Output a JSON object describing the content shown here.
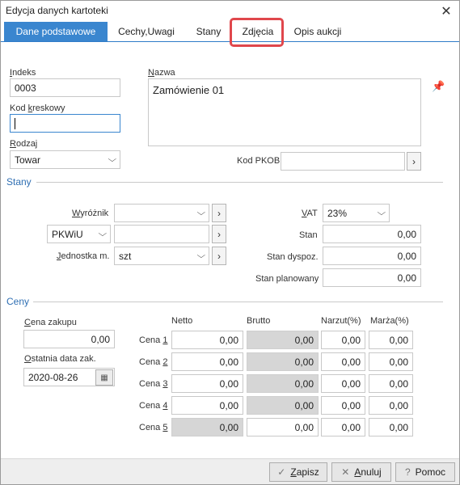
{
  "window": {
    "title": "Edycja danych kartoteki"
  },
  "tabs": [
    {
      "label": "Dane podstawowe"
    },
    {
      "label": "Cechy,Uwagi"
    },
    {
      "label": "Stany"
    },
    {
      "label": "Zdjęcia"
    },
    {
      "label": "Opis aukcji"
    }
  ],
  "basic": {
    "indeks_label_u": "I",
    "indeks_label_rest": "ndeks",
    "indeks_value": "0003",
    "kod_label_a": "Kod ",
    "kod_label_u": "k",
    "kod_label_rest": "reskowy",
    "kod_value": "",
    "rodzaj_label_u": "R",
    "rodzaj_label_rest": "odzaj",
    "rodzaj_value": "Towar",
    "nazwa_label_u": "N",
    "nazwa_label_rest": "azwa",
    "nazwa_value": "Zamówienie 01",
    "pkob_label": "Kod PKOB",
    "pkob_value": ""
  },
  "stany": {
    "title": "Stany",
    "wyroznik_label_u": "W",
    "wyroznik_label_rest": "yróżnik",
    "wyroznik_value": "",
    "pkwiu_select": "PKWiU",
    "pkwiu_value": "",
    "jednostka_label_u": "J",
    "jednostka_label_rest": "ednostka m.",
    "jednostka_value": "szt",
    "vat_label_u": "V",
    "vat_label_rest": "AT",
    "vat_value": "23%",
    "stan_label": "Stan",
    "stan_value": "0,00",
    "stan_dyspoz_label": "Stan dyspoz.",
    "stan_dyspoz_value": "0,00",
    "stan_plan_label": "Stan planowany",
    "stan_plan_value": "0,00"
  },
  "ceny": {
    "title": "Ceny",
    "cena_zakupu_label_u": "C",
    "cena_zakupu_label_rest": "ena zakupu",
    "cena_zakupu_value": "0,00",
    "data_label_u": "O",
    "data_label_rest": "statnia data zak.",
    "data_value": "2020-08-26",
    "columns": [
      "Netto",
      "Brutto",
      "Narzut(%)",
      "Marża(%)"
    ],
    "rows": [
      {
        "label": "Cena ",
        "num": "1",
        "netto": "0,00",
        "brutto": "0,00",
        "narzut": "0,00",
        "marza": "0,00"
      },
      {
        "label": "Cena ",
        "num": "2",
        "netto": "0,00",
        "brutto": "0,00",
        "narzut": "0,00",
        "marza": "0,00"
      },
      {
        "label": "Cena ",
        "num": "3",
        "netto": "0,00",
        "brutto": "0,00",
        "narzut": "0,00",
        "marza": "0,00"
      },
      {
        "label": "Cena ",
        "num": "4",
        "netto": "0,00",
        "brutto": "0,00",
        "narzut": "0,00",
        "marza": "0,00"
      },
      {
        "label": "Cena ",
        "num": "5",
        "netto": "0,00",
        "brutto": "0,00",
        "narzut": "0,00",
        "marza": "0,00"
      }
    ]
  },
  "footer": {
    "save_u": "Z",
    "save_rest": "apisz",
    "cancel_u": "A",
    "cancel_rest": "nuluj",
    "help_label": "Pomoc"
  },
  "colors": {
    "accent": "#3a86cf",
    "highlight": "#e0474c",
    "section": "#2f6fb3",
    "disabled": "#d6d6d6"
  },
  "icons": [
    "close-icon",
    "pin-icon",
    "chevron-down-icon",
    "chevron-right-icon",
    "calendar-icon",
    "check-icon",
    "x-icon",
    "question-icon"
  ]
}
